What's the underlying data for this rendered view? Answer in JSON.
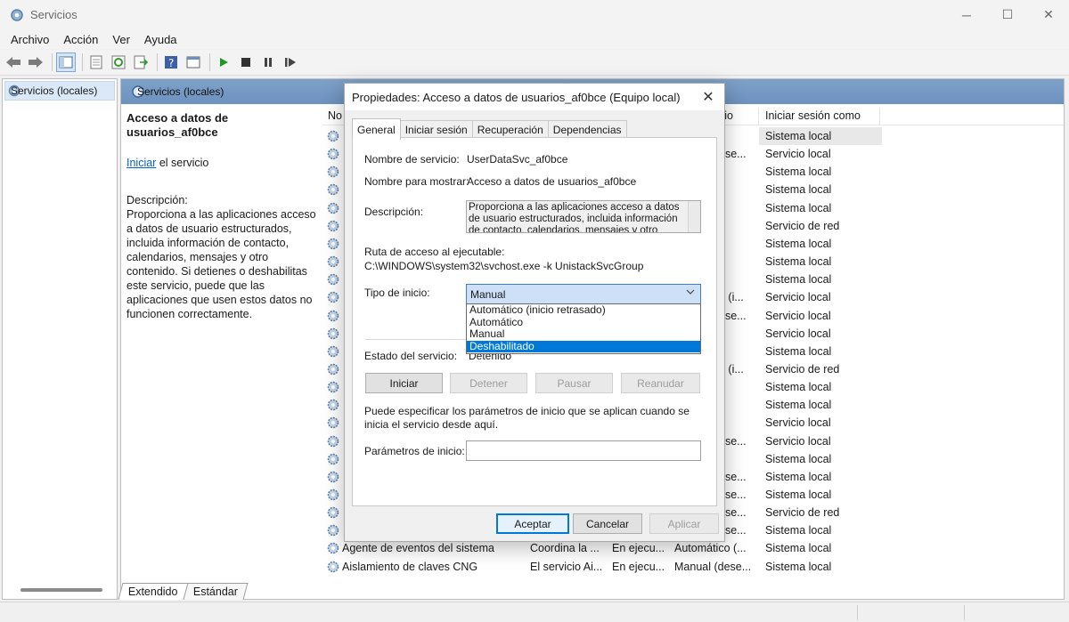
{
  "window": {
    "title": "Servicios",
    "minimize": "─",
    "maximize": "☐",
    "close": "✕"
  },
  "menu": [
    "Archivo",
    "Acción",
    "Ver",
    "Ayuda"
  ],
  "tree": {
    "root": "Servicios (locales)"
  },
  "pane": {
    "header": "Servicios (locales)",
    "selected_service": "Acceso a datos de usuarios_af0bce",
    "start_link": "Iniciar",
    "start_suffix": " el servicio",
    "description_label": "Descripción:",
    "description": "Proporciona a las aplicaciones acceso a datos de usuario estructurados, incluida información de contacto, calendarios, mensajes y otro contenido. Si detienes o deshabilitas este servicio, puede que las aplicaciones que usen estos datos no funcionen correctamente."
  },
  "list": {
    "columns": {
      "name": "No",
      "desc_tail": "cio",
      "logon": "Iniciar sesión como"
    },
    "rows": [
      {
        "state_tail": "",
        "logon": "Sistema local"
      },
      {
        "state_tail": "ese...",
        "logon": "Servicio local"
      },
      {
        "state_tail": "",
        "logon": "Sistema local"
      },
      {
        "state_tail": "",
        "logon": "Sistema local"
      },
      {
        "state_tail": "",
        "logon": "Sistema local"
      },
      {
        "state_tail": "",
        "logon": "Servicio de red"
      },
      {
        "state_tail": "",
        "logon": "Sistema local"
      },
      {
        "state_tail": "",
        "logon": "Sistema local"
      },
      {
        "state_tail": "o",
        "logon": "Sistema local"
      },
      {
        "state_tail": "o (i...",
        "logon": "Servicio local"
      },
      {
        "state_tail": "ese...",
        "logon": "Servicio local"
      },
      {
        "state_tail": "",
        "logon": "Servicio local"
      },
      {
        "state_tail": "o",
        "logon": "Sistema local"
      },
      {
        "state_tail": "o (i...",
        "logon": "Servicio de red"
      },
      {
        "state_tail": "o",
        "logon": "Sistema local"
      },
      {
        "state_tail": "o",
        "logon": "Sistema local"
      },
      {
        "state_tail": "o",
        "logon": "Servicio local"
      },
      {
        "state_tail": "ese...",
        "logon": "Servicio local"
      },
      {
        "state_tail": "",
        "logon": "Sistema local"
      },
      {
        "state_tail": "ese...",
        "logon": "Sistema local"
      },
      {
        "state_tail": "ese...",
        "logon": "Sistema local"
      },
      {
        "state_tail": "ese...",
        "logon": "Servicio de red"
      },
      {
        "state_tail": "ese...",
        "logon": "Sistema local"
      }
    ],
    "bottom_rows": [
      {
        "name": "Agente de eventos del sistema",
        "desc": "Coordina la ...",
        "state": "En ejecu...",
        "type": "Automático (...",
        "logon": "Sistema local"
      },
      {
        "name": "Aislamiento de claves CNG",
        "desc": "El servicio Ai...",
        "state": "En ejecu...",
        "type": "Manual (dese...",
        "logon": "Sistema local"
      }
    ]
  },
  "bottom_tabs": [
    "Extendido",
    "Estándar"
  ],
  "dialog": {
    "title": "Propiedades: Acceso a datos de usuarios_af0bce (Equipo local)",
    "tabs": [
      "General",
      "Iniciar sesión",
      "Recuperación",
      "Dependencias"
    ],
    "service_name_label": "Nombre de servicio:",
    "service_name": "UserDataSvc_af0bce",
    "display_name_label": "Nombre para mostrar:",
    "display_name": "Acceso a datos de usuarios_af0bce",
    "description_label": "Descripción:",
    "description": "Proporciona a las aplicaciones acceso a datos de usuario estructurados, incluida información de contacto, calendarios, mensajes y otro",
    "path_label": "Ruta de acceso al ejecutable:",
    "path": "C:\\WINDOWS\\system32\\svchost.exe -k UnistackSvcGroup",
    "startup_label": "Tipo de inicio:",
    "startup_value": "Manual",
    "startup_options": [
      "Automático (inicio retrasado)",
      "Automático",
      "Manual",
      "Deshabilitado"
    ],
    "status_label": "Estado del servicio:",
    "status_value": "Detenido",
    "buttons": {
      "start": "Iniciar",
      "stop": "Detener",
      "pause": "Pausar",
      "resume": "Reanudar"
    },
    "params_hint": "Puede especificar los parámetros de inicio que se aplican cuando se inicia el servicio desde aquí.",
    "params_label": "Parámetros de inicio:",
    "footer": {
      "ok": "Aceptar",
      "cancel": "Cancelar",
      "apply": "Aplicar"
    }
  },
  "colors": {
    "accent": "#0078d7",
    "header_blue": "#7ea1c9",
    "highlight": "#0078d7"
  }
}
